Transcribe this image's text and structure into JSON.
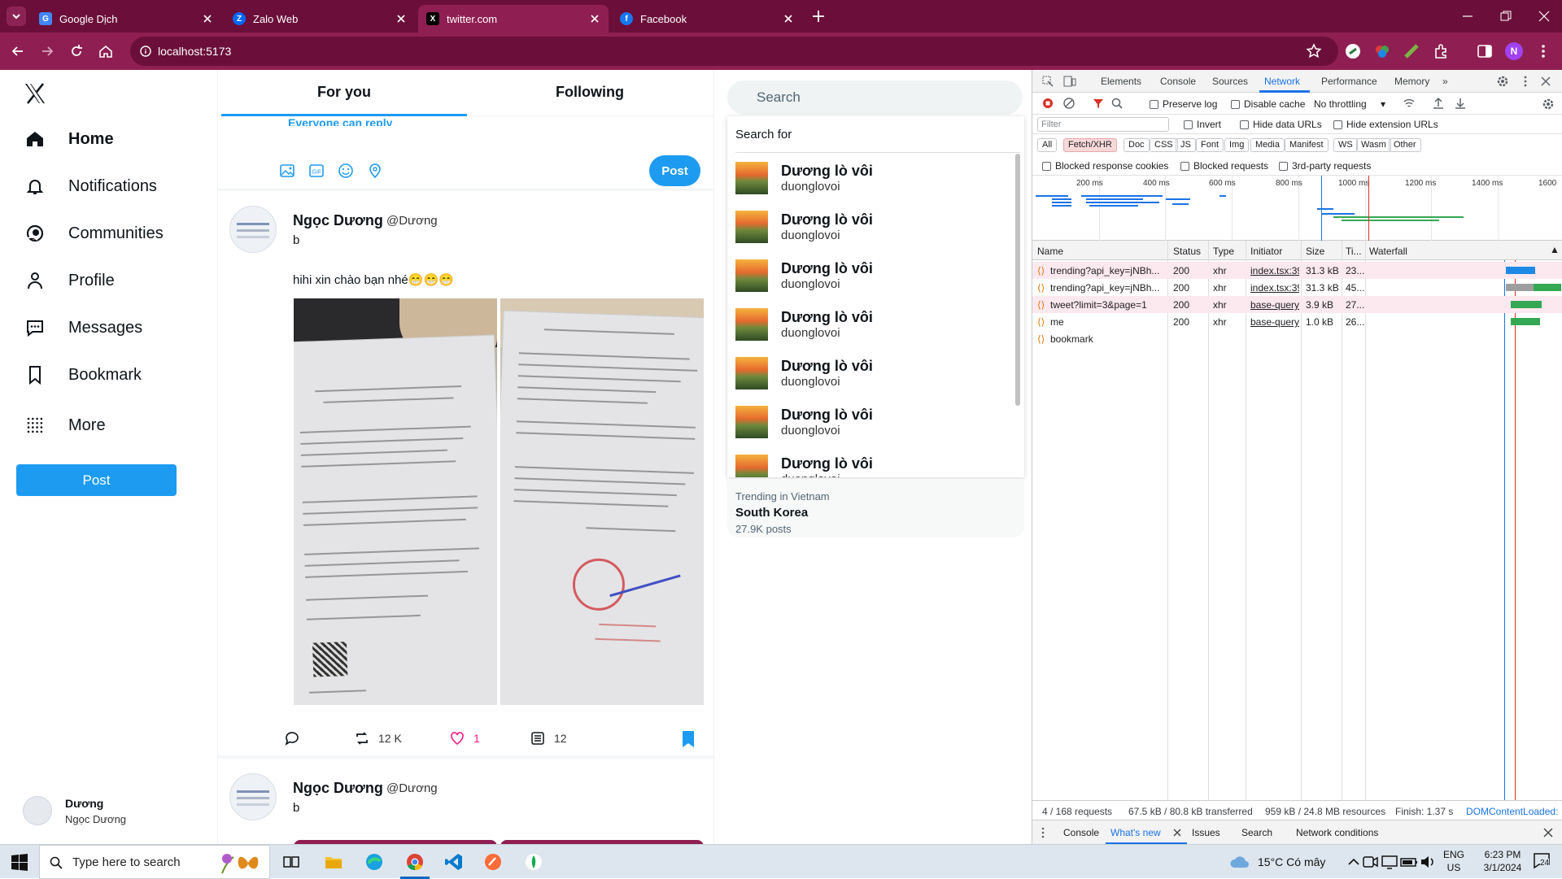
{
  "browser": {
    "tabs": [
      {
        "title": "Google Dịch",
        "active": false
      },
      {
        "title": "Zalo Web",
        "active": false
      },
      {
        "title": "twitter.com",
        "active": true
      },
      {
        "title": "Facebook",
        "active": false
      }
    ],
    "url": "localhost:5173",
    "profile_initial": "N",
    "accent": "#8f1f52"
  },
  "sidebar": {
    "items": [
      {
        "label": "Home"
      },
      {
        "label": "Notifications"
      },
      {
        "label": "Communities"
      },
      {
        "label": "Profile"
      },
      {
        "label": "Messages"
      },
      {
        "label": "Bookmark"
      },
      {
        "label": "More"
      }
    ],
    "post_label": "Post",
    "user_display": "Dương",
    "user_name": "Ngọc Dương"
  },
  "feed": {
    "tabs": [
      "For you",
      "Following"
    ],
    "reply_note": "Everyone can reply",
    "post_label": "Post",
    "tweets": [
      {
        "name": "Ngọc Dương",
        "handle": "@Dương",
        "first_line": "b",
        "text": "hihi xin chào bạn nhé😁😁😁",
        "retweets": "12 K",
        "likes": "1",
        "views": "12"
      },
      {
        "name": "Ngọc Dương",
        "handle": "@Dương",
        "first_line": "b"
      }
    ]
  },
  "search": {
    "placeholder": "Search",
    "header": "Search for",
    "results": [
      {
        "name": "Dương lò vôi",
        "username": "duonglovoi"
      },
      {
        "name": "Dương lò vôi",
        "username": "duonglovoi"
      },
      {
        "name": "Dương lò vôi",
        "username": "duonglovoi"
      },
      {
        "name": "Dương lò vôi",
        "username": "duonglovoi"
      },
      {
        "name": "Dương lò vôi",
        "username": "duonglovoi"
      },
      {
        "name": "Dương lò vôi",
        "username": "duonglovoi"
      },
      {
        "name": "Dương lò vôi",
        "username": "duonglovoi"
      }
    ],
    "trend": {
      "location": "Trending in Vietnam",
      "topic": "South Korea",
      "posts": "27.9K posts"
    }
  },
  "devtools": {
    "tabs": [
      "Elements",
      "Console",
      "Sources",
      "Network",
      "Performance",
      "Memory"
    ],
    "active_tab": "Network",
    "preserve_log": "Preserve log",
    "disable_cache": "Disable cache",
    "throttling": "No throttling",
    "filter_placeholder": "Filter",
    "invert": "Invert",
    "hide_data_urls": "Hide data URLs",
    "hide_ext_urls": "Hide extension URLs",
    "type_filters": [
      "All",
      "Fetch/XHR",
      "Doc",
      "CSS",
      "JS",
      "Font",
      "Img",
      "Media",
      "Manifest",
      "WS",
      "Wasm",
      "Other"
    ],
    "active_filter": "Fetch/XHR",
    "blocked_cookies": "Blocked response cookies",
    "blocked_requests": "Blocked requests",
    "third_party": "3rd-party requests",
    "timeline_ticks": [
      "200 ms",
      "400 ms",
      "600 ms",
      "800 ms",
      "1000 ms",
      "1200 ms",
      "1400 ms",
      "1600"
    ],
    "columns": [
      "Name",
      "Status",
      "Type",
      "Initiator",
      "Size",
      "Ti...",
      "Waterfall"
    ],
    "requests": [
      {
        "name": "trending?api_key=jNBh...",
        "status": "200",
        "type": "xhr",
        "initiator": "index.tsx:39",
        "size": "31.3 kB",
        "time": "23..."
      },
      {
        "name": "trending?api_key=jNBh...",
        "status": "200",
        "type": "xhr",
        "initiator": "index.tsx:39",
        "size": "31.3 kB",
        "time": "45..."
      },
      {
        "name": "tweet?limit=3&page=1",
        "status": "200",
        "type": "xhr",
        "initiator": "base-query...",
        "size": "3.9 kB",
        "time": "27..."
      },
      {
        "name": "me",
        "status": "200",
        "type": "xhr",
        "initiator": "base-query...",
        "size": "1.0 kB",
        "time": "26..."
      },
      {
        "name": "bookmark",
        "status": "",
        "type": "",
        "initiator": "",
        "size": "",
        "time": ""
      }
    ],
    "summary": {
      "requests": "4 / 168 requests",
      "transferred": "67.5 kB / 80.8 kB transferred",
      "resources": "959 kB / 24.8 MB resources",
      "finish": "Finish: 1.37 s",
      "dcl": "DOMContentLoaded:"
    },
    "drawer_tabs": [
      "Console",
      "What's new",
      "Issues",
      "Search",
      "Network conditions"
    ],
    "drawer_active": "What's new"
  },
  "taskbar": {
    "search_placeholder": "Type here to search",
    "weather": "15°C  Có mây",
    "lang1": "ENG",
    "lang2": "US",
    "time": "6:23 PM",
    "date": "3/1/2024",
    "notifications": "24"
  }
}
